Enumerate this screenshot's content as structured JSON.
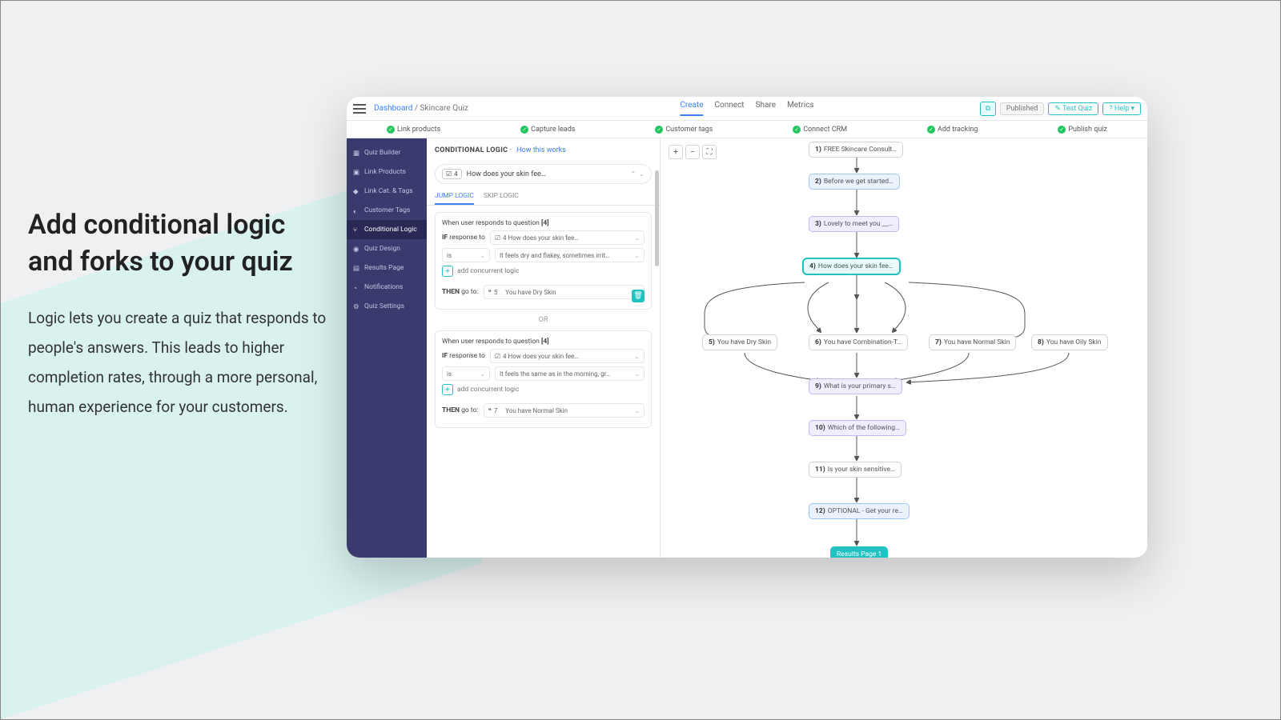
{
  "hero": {
    "title_line1": "Add conditional logic",
    "title_line2": "and forks to your quiz",
    "body": "Logic lets you create a quiz that responds to people's answers. This leads to higher completion rates, through a more personal, human experience for your customers."
  },
  "breadcrumb": {
    "dashboard": "Dashboard",
    "sep": "/",
    "current": "Skincare Quiz"
  },
  "topnav": [
    "Create",
    "Connect",
    "Share",
    "Metrics"
  ],
  "topright": {
    "published": "Published",
    "test": "Test Quiz",
    "help": "Help"
  },
  "progress": [
    "Link products",
    "Capture leads",
    "Customer tags",
    "Connect CRM",
    "Add tracking",
    "Publish quiz"
  ],
  "sidebar": [
    "Quiz Builder",
    "Link Products",
    "Link Cat. & Tags",
    "Customer Tags",
    "Conditional Logic",
    "Quiz Design",
    "Results Page",
    "Notifications",
    "Quiz Settings"
  ],
  "panel": {
    "title": "CONDITIONAL LOGIC",
    "sep": "·",
    "howlink": "How this works",
    "q_badge_num": "4",
    "q_text": "How does your skin fee…",
    "tab_jump": "JUMP LOGIC",
    "tab_skip": "SKIP LOGIC",
    "when_prefix": "When user responds to question ",
    "when_num": "[4]",
    "if_label": "IF",
    "if_text": "response to",
    "sel_q4": "4   How does your skin fee…",
    "is_label": "is",
    "resp1": "It feels dry and flakey, sometimes irrit…",
    "add_conc": "add concurrent logic",
    "then_label": "THEN",
    "then_text": "go to:",
    "then_val1_num": "5",
    "then_val1": "You have Dry Skin",
    "or": "OR",
    "resp2": "It feels the same as in the morning, gr…",
    "then_val2_num": "7",
    "then_val2": "You have Normal Skin"
  },
  "nodes": {
    "n1": "FREE Skincare Consult…",
    "n2": "Before we get started…",
    "n3": "Lovely to meet you __…",
    "n4": "How does your skin fee…",
    "n5": "You have Dry Skin",
    "n6": "You have Combination-T…",
    "n7": "You have Normal Skin",
    "n8": "You have Oily Skin",
    "n9": "What is your primary s…",
    "n10": "Which of the following…",
    "n11": "Is your skin sensitive…",
    "n12": "OPTIONAL - Get your re…",
    "result": "Results Page 1"
  }
}
